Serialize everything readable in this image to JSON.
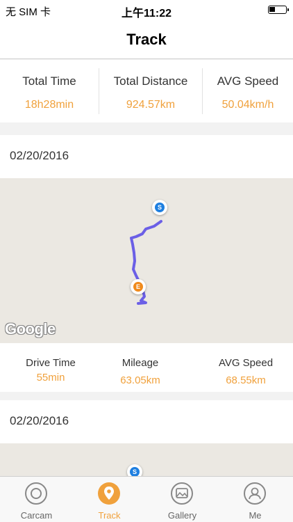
{
  "status_bar": {
    "carrier": "无 SIM 卡",
    "time": "上午11:22",
    "battery_level": 0.35
  },
  "header": {
    "title": "Track"
  },
  "summary": {
    "total_time_label": "Total Time",
    "total_time_value": "18h28min",
    "total_distance_label": "Total Distance",
    "total_distance_value": "924.57km",
    "avg_speed_label": "AVG Speed",
    "avg_speed_value": "50.04km/h"
  },
  "trips": [
    {
      "date": "02/20/2016",
      "start_marker": "S",
      "end_marker": "E",
      "drive_time_label": "Drive Time",
      "drive_time_value": "55min",
      "mileage_label": "Mileage",
      "mileage_value": "63.05km",
      "avg_speed_label": "AVG Speed",
      "avg_speed_value": "68.55km"
    },
    {
      "date": "02/20/2016",
      "start_marker": "S"
    }
  ],
  "map": {
    "provider_logo": "Google",
    "route_color": "#6b5fe6"
  },
  "tabs": [
    {
      "label": "Carcam",
      "icon": "camera-lens-icon",
      "active": false
    },
    {
      "label": "Track",
      "icon": "map-pin-icon",
      "active": true
    },
    {
      "label": "Gallery",
      "icon": "gallery-icon",
      "active": false
    },
    {
      "label": "Me",
      "icon": "user-icon",
      "active": false
    }
  ],
  "colors": {
    "accent": "#f0a13c",
    "start_marker": "#1e7fe0",
    "end_marker": "#f08a1c"
  }
}
